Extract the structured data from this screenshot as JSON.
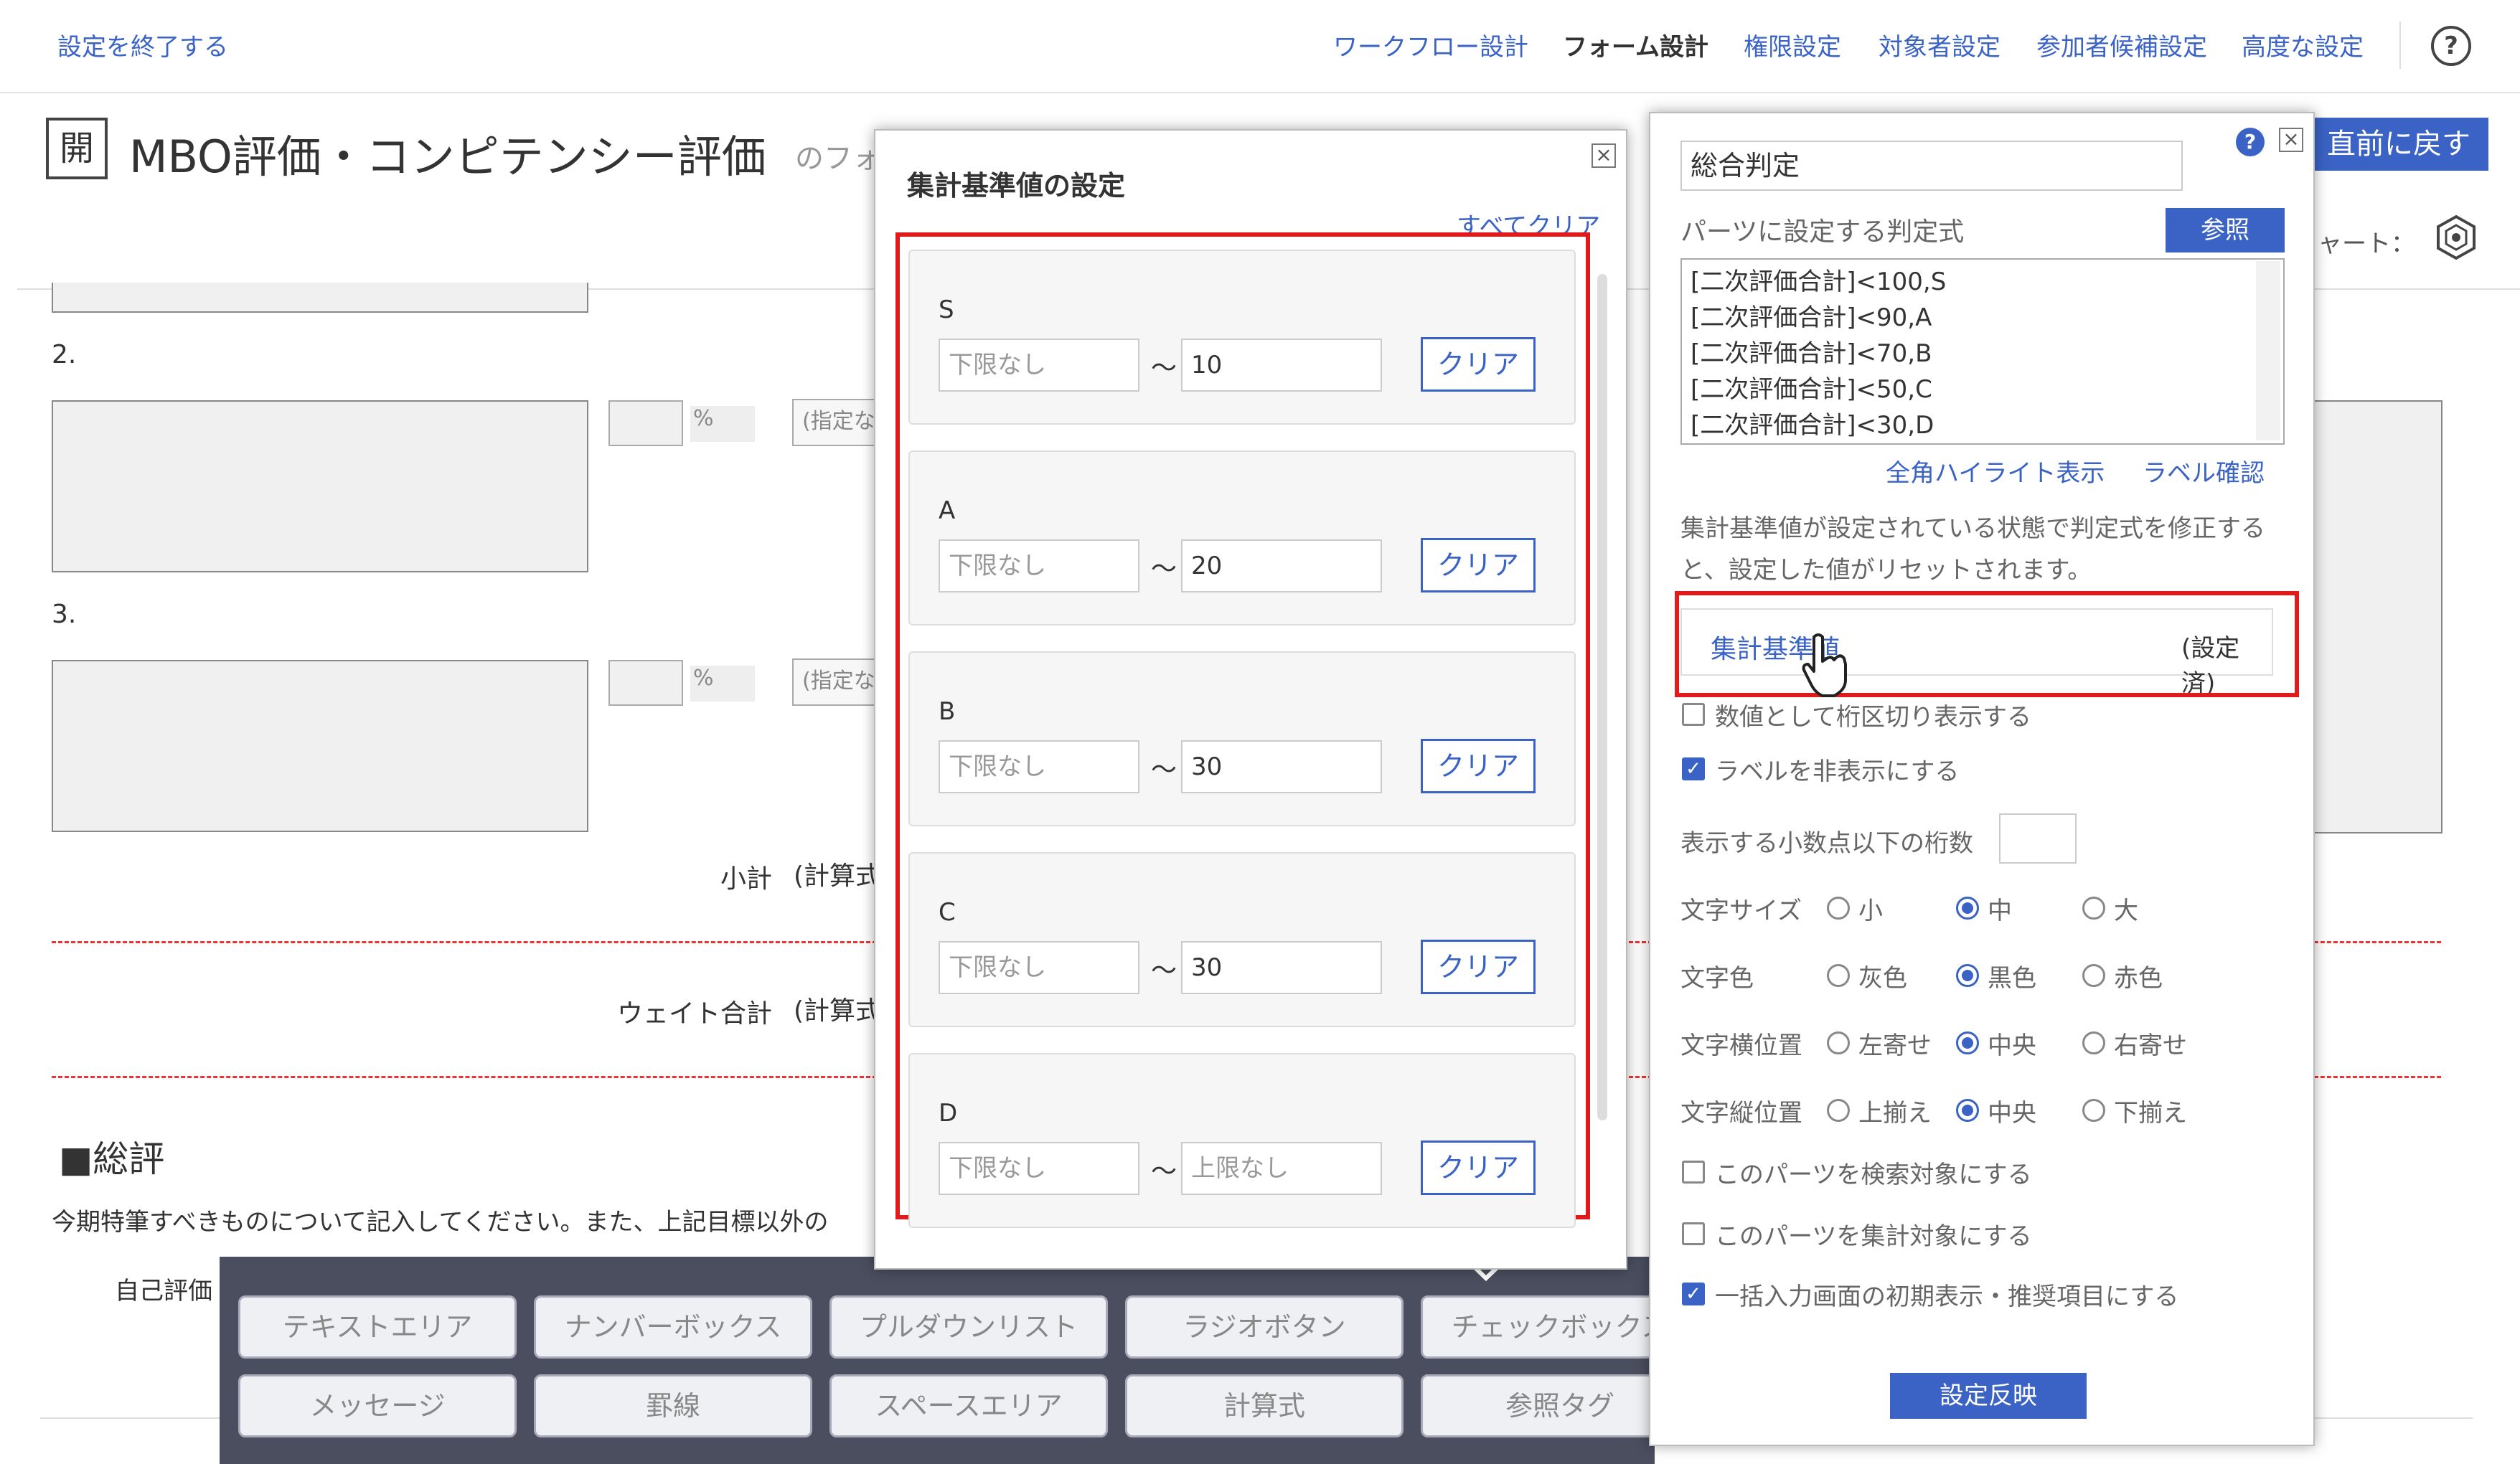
{
  "nav": {
    "exit": "設定を終了する",
    "items": [
      "ワークフロー設計",
      "フォーム設計",
      "権限設定",
      "対象者設定",
      "参加者候補設定",
      "高度な設定"
    ],
    "help": "?"
  },
  "title": {
    "badge": "開",
    "text": "MBO評価・コンピテンシー評価",
    "suffix": "のフォ",
    "undo": "直前に戻す",
    "chart_label": "ャート："
  },
  "form": {
    "item2": "2.",
    "item3": "3.",
    "pct": "%",
    "placeholder": "(指定な",
    "subtotal": "小計",
    "calc": "(計算式",
    "weight_total": "ウェイト合計",
    "section": "■総評",
    "instruction": "今期特筆すべきものについて記入してください。また、上記目標以外の",
    "self_eval": "自己評価"
  },
  "dialog1": {
    "title": "集計基準値の設定",
    "clear_all": "すべてクリア",
    "ranks": [
      {
        "name": "S",
        "lower": "下限なし",
        "upper": "10"
      },
      {
        "name": "A",
        "lower": "下限なし",
        "upper": "20"
      },
      {
        "name": "B",
        "lower": "下限なし",
        "upper": "30"
      },
      {
        "name": "C",
        "lower": "下限なし",
        "upper": "30"
      },
      {
        "name": "D",
        "lower": "下限なし",
        "upper": "上限なし"
      }
    ],
    "tilde": "～",
    "clear": "クリア"
  },
  "dialog2": {
    "name": "総合判定",
    "formula_label": "パーツに設定する判定式",
    "ref_button": "参照",
    "formula": [
      "[二次評価合計]<100,S",
      "[二次評価合計]<90,A",
      "[二次評価合計]<70,B",
      "[二次評価合計]<50,C",
      "[二次評価合計]<30,D"
    ],
    "highlight_link": "全角ハイライト表示",
    "label_link": "ラベル確認",
    "note": "集計基準値が設定されている状態で判定式を修正すると、設定した値がリセットされます。",
    "agg_link": "集計基準値",
    "agg_status": "(設定済)",
    "numeric_sep": "数値として桁区切り表示する",
    "hide_label": "ラベルを非表示にする",
    "decimals": "表示する小数点以下の桁数",
    "font_size": {
      "label": "文字サイズ",
      "options": [
        "小",
        "中",
        "大"
      ],
      "selected": 1
    },
    "font_color": {
      "label": "文字色",
      "options": [
        "灰色",
        "黒色",
        "赤色"
      ],
      "selected": 1
    },
    "h_align": {
      "label": "文字横位置",
      "options": [
        "左寄せ",
        "中央",
        "右寄せ"
      ],
      "selected": 1
    },
    "v_align": {
      "label": "文字縦位置",
      "options": [
        "上揃え",
        "中央",
        "下揃え"
      ],
      "selected": 1
    },
    "search_target": "このパーツを検索対象にする",
    "agg_target": "このパーツを集計対象にする",
    "bulk_input": "一括入力画面の初期表示・推奨項目にする",
    "apply": "設定反映"
  },
  "palette": {
    "row1": [
      "テキストエリア",
      "ナンバーボックス",
      "プルダウンリスト",
      "ラジオボタン",
      "チェックボックス"
    ],
    "row2": [
      "メッセージ",
      "罫線",
      "スペースエリア",
      "計算式",
      "参照タグ"
    ]
  },
  "colors": {
    "accent": "#3a63c5",
    "highlight": "#e01b1b"
  }
}
